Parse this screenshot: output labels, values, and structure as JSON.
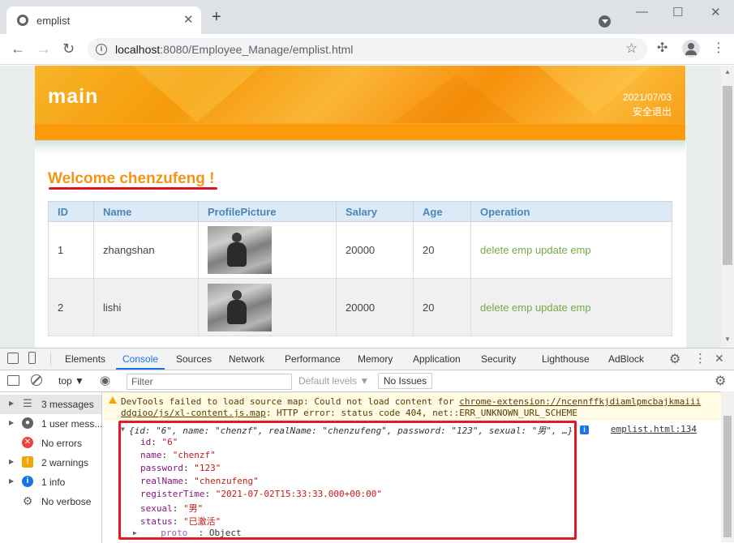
{
  "browser": {
    "tab_title": "emplist",
    "new_tab": "+",
    "window_controls": {
      "minimize": "—",
      "maximize": "☐",
      "close": "✕"
    },
    "address": {
      "host": "localhost",
      "path": ":8080/Employee_Manage/emplist.html"
    }
  },
  "page": {
    "brand": "main",
    "date": "2021/07/03",
    "logout": "安全退出",
    "welcome": "Welcome chenzufeng !",
    "table": {
      "headers": [
        "ID",
        "Name",
        "ProfilePicture",
        "Salary",
        "Age",
        "Operation"
      ],
      "rows": [
        {
          "id": "1",
          "name": "zhangshan",
          "salary": "20000",
          "age": "20",
          "delete": "delete emp",
          "update": "update emp"
        },
        {
          "id": "2",
          "name": "lishi",
          "salary": "20000",
          "age": "20",
          "delete": "delete emp",
          "update": "update emp"
        }
      ]
    }
  },
  "devtools": {
    "tabs": [
      "Elements",
      "Console",
      "Sources",
      "Network",
      "Performance",
      "Memory",
      "Application",
      "Security",
      "Lighthouse",
      "AdBlock"
    ],
    "active_tab": "Console",
    "toolbar": {
      "context": "top ▼",
      "filter_placeholder": "Filter",
      "levels": "Default levels ▼",
      "issues": "No Issues"
    },
    "sidebar": [
      {
        "label": "3 messages",
        "icon": "list-icon"
      },
      {
        "label": "1 user mess...",
        "icon": "user-icon"
      },
      {
        "label": "No errors",
        "icon": "error-icon"
      },
      {
        "label": "2 warnings",
        "icon": "warning-icon"
      },
      {
        "label": "1 info",
        "icon": "info-icon"
      },
      {
        "label": "No verbose",
        "icon": "gear-icon"
      }
    ],
    "warning": {
      "line1_prefix": "DevTools failed to load source map: Could not load content for ",
      "line1_link": "chrome-extension://ncennffkjdiamlpmcbajkmaiii",
      "line2_link": "ddgioo/js/xl-content.js.map",
      "line2_suffix": ": HTTP error: status code 404, net::ERR_UNKNOWN_URL_SCHEME"
    },
    "object": {
      "summary": "{id: \"6\", name: \"chenzf\", realName: \"chenzufeng\", password: \"123\", sexual: \"男\", …}",
      "source": "emplist.html:134",
      "props": [
        {
          "key": "id",
          "value": "\"6\""
        },
        {
          "key": "name",
          "value": "\"chenzf\""
        },
        {
          "key": "password",
          "value": "\"123\""
        },
        {
          "key": "realName",
          "value": "\"chenzufeng\""
        },
        {
          "key": "registerTime",
          "value": "\"2021-07-02T15:33:33.000+00:00\""
        },
        {
          "key": "sexual",
          "value": "\"男\""
        },
        {
          "key": "status",
          "value": "\"已激活\""
        }
      ],
      "proto": "__proto__",
      "proto_value": ": Object"
    }
  },
  "colors": {
    "banner": "#f79a0b",
    "welcome": "#f49515",
    "highlight": "#e01b24",
    "link": "#73a94b"
  }
}
